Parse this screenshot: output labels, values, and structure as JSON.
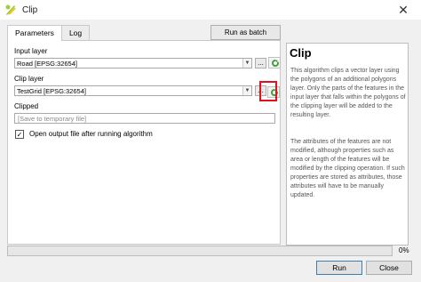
{
  "window": {
    "title": "Clip",
    "close_glyph": "✕"
  },
  "tabs": [
    {
      "label": "Parameters"
    },
    {
      "label": "Log"
    }
  ],
  "batch_button": {
    "label": "Run as batch process..."
  },
  "input_layer": {
    "label": "Input layer",
    "value": "Road [EPSG:32654]"
  },
  "clip_layer": {
    "label": "Clip layer",
    "value": "TestGrid [EPSG:32654]"
  },
  "clipped": {
    "label": "Clipped",
    "placeholder": "[Save to temporary file]"
  },
  "open_output": {
    "label": "Open output file after running algorithm",
    "checked": true
  },
  "browse_label": "...",
  "help": {
    "title": "Clip",
    "para1": "This algorithm clips a vector layer using the polygons of an additional polygons layer. Only the parts of the features in the input layer that falls within the polygons of the clipping layer will be added to the resulting layer.",
    "para2": "The attributes of the features are not modified, although properties such as area or length of the features will be modified by the clipping operation. If such properties are stored as attributes, those attributes will have to be manually updated."
  },
  "progress": {
    "value": 0,
    "text": "0%"
  },
  "buttons": {
    "run": "Run",
    "close": "Close"
  },
  "icons": {
    "app": "qgis-icon",
    "iterate": "iterate-over-features-icon",
    "dropdown": "chevron-down-icon"
  },
  "colors": {
    "highlight": "#e0121d",
    "iterate_green": "#3f9e3f"
  }
}
